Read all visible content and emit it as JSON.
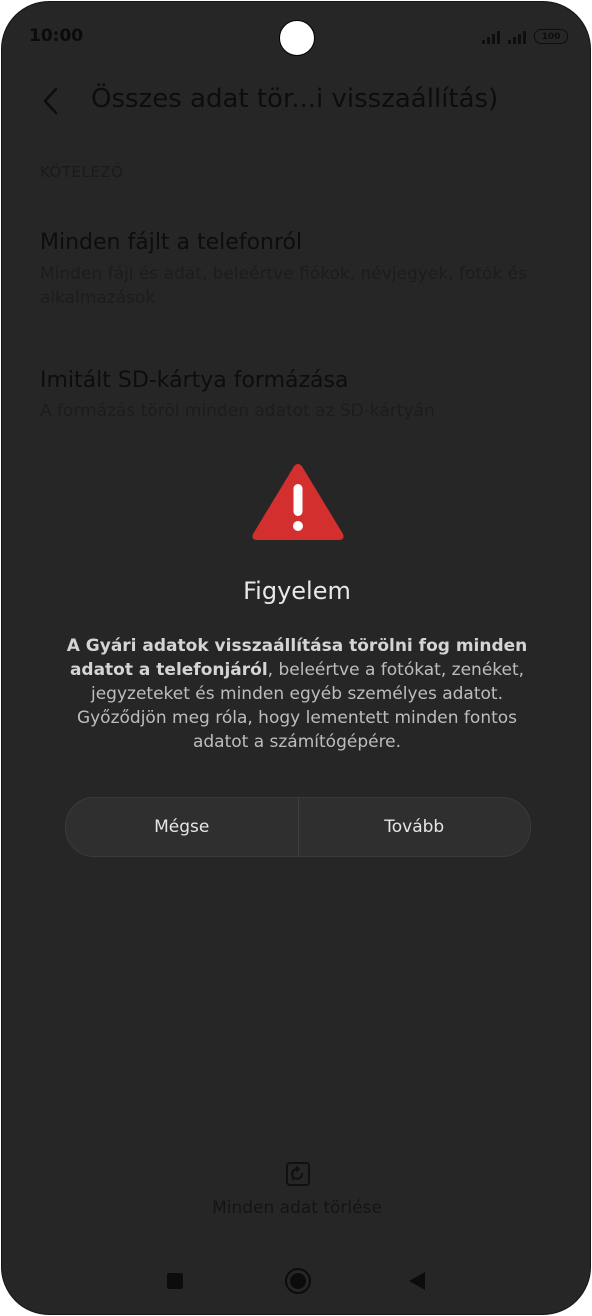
{
  "status_bar": {
    "time": "10:00",
    "battery": "100"
  },
  "header": {
    "title": "Összes adat tör...i visszaállítás)"
  },
  "section": {
    "label": "KÖTELEZŐ"
  },
  "items": [
    {
      "title": "Minden fájlt a telefonról",
      "description": "Minden fájl és adat, beleértve fiókok, névjegyek, fotók és alkalmazások"
    },
    {
      "title": "Imitált SD-kártya formázása",
      "description": "A formázás töröl minden adatot az SD-kártyán"
    }
  ],
  "dialog": {
    "title": "Figyelem",
    "message_bold": "A Gyári adatok visszaállítása törölni fog minden adatot a telefonjáról",
    "message_rest": ", beleértve a fotókat, zenéket, jegyzeteket és minden egyéb személyes adatot. Győződjön meg róla, hogy lementett minden fontos adatot a számítógépére.",
    "cancel_label": "Mégse",
    "confirm_label": "Tovább",
    "accent_color": "#d32f2f"
  },
  "bottom_action": {
    "label": "Minden adat törlése",
    "icon": "reset-icon"
  },
  "nav_bar": {
    "icons": [
      "recents-square-icon",
      "home-circle-icon",
      "back-triangle-icon"
    ]
  }
}
